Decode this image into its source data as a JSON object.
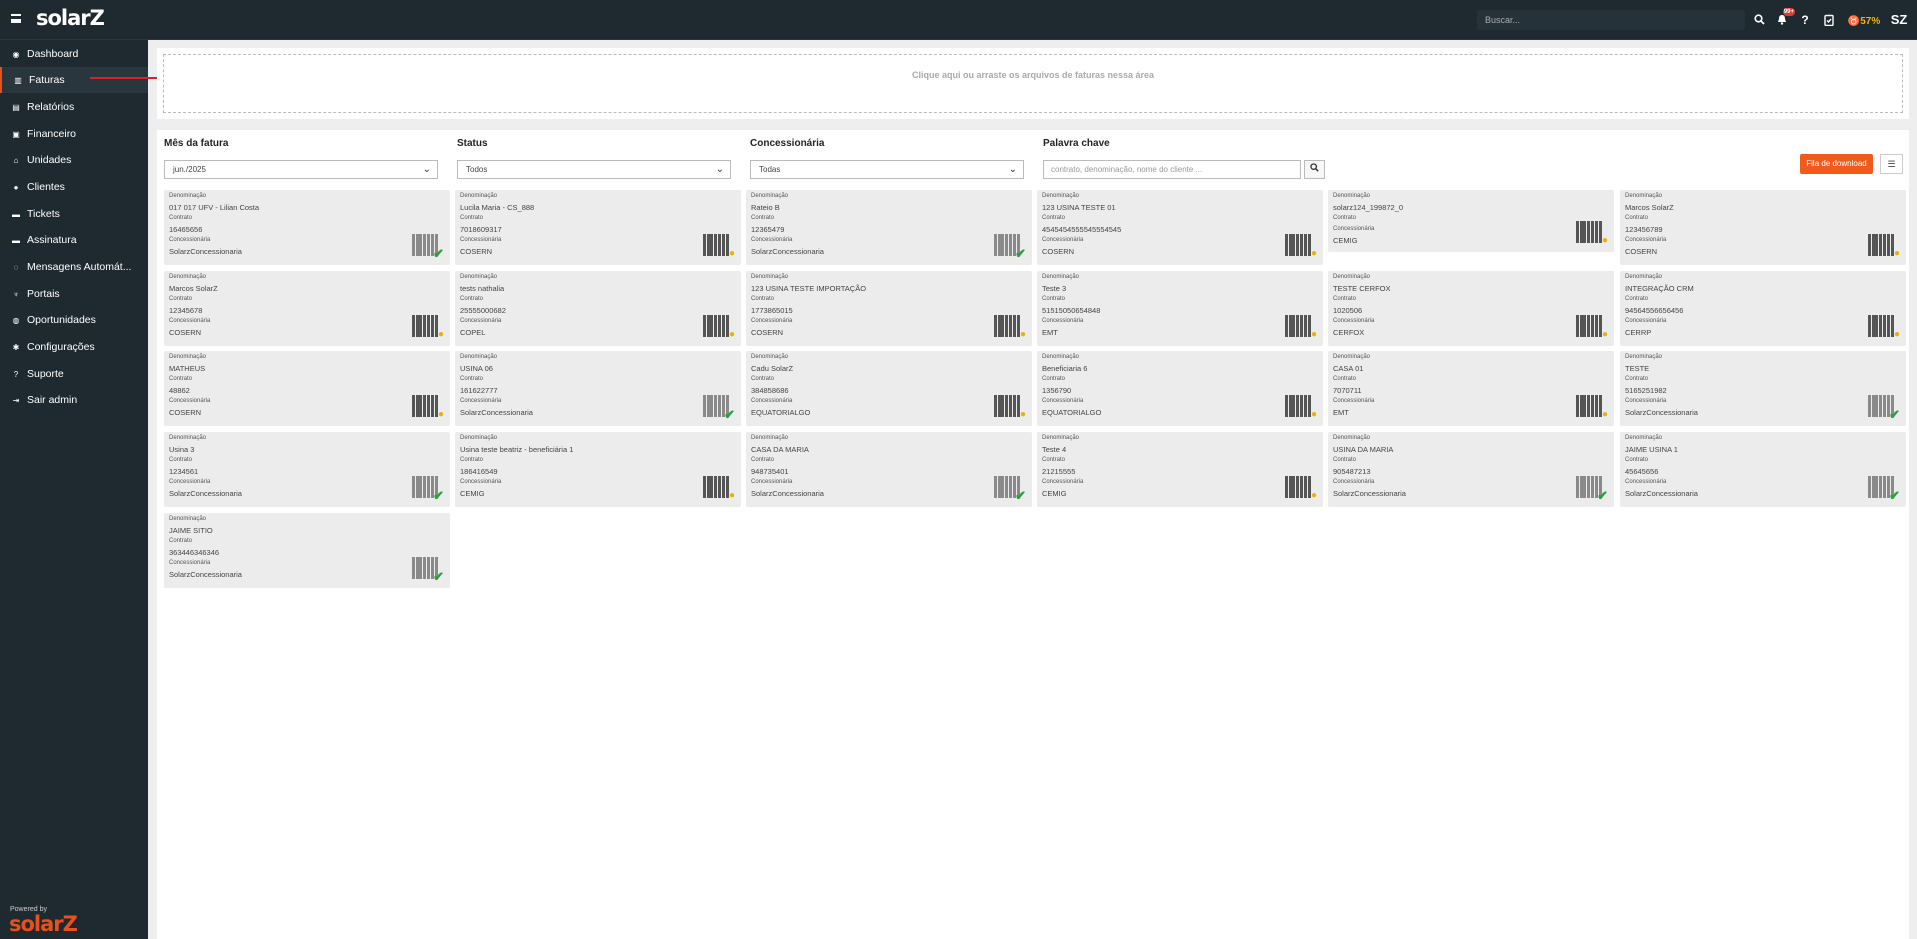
{
  "header": {
    "brand": "solarZ",
    "search_placeholder": "Buscar...",
    "notif_badge": "99+",
    "help": "?",
    "progress": "57%",
    "avatar": "SZ"
  },
  "sidebar": {
    "items": [
      {
        "label": "Dashboard",
        "icon": "gauge-icon",
        "glyph": "◉"
      },
      {
        "label": "Faturas",
        "icon": "invoice-icon",
        "glyph": "▥"
      },
      {
        "label": "Relatórios",
        "icon": "report-icon",
        "glyph": "▤"
      },
      {
        "label": "Financeiro",
        "icon": "money-icon",
        "glyph": "▣"
      },
      {
        "label": "Unidades",
        "icon": "home-icon",
        "glyph": "⌂"
      },
      {
        "label": "Clientes",
        "icon": "user-icon",
        "glyph": "●"
      },
      {
        "label": "Tickets",
        "icon": "ticket-icon",
        "glyph": "▬"
      },
      {
        "label": "Assinatura",
        "icon": "signature-icon",
        "glyph": "▬"
      },
      {
        "label": "Mensagens Automát...",
        "icon": "whatsapp-icon",
        "glyph": "◌"
      },
      {
        "label": "Portais",
        "icon": "plug-icon",
        "glyph": "♆"
      },
      {
        "label": "Oportunidades",
        "icon": "search-icon",
        "glyph": "◍"
      },
      {
        "label": "Configurações",
        "icon": "gear-icon",
        "glyph": "✱"
      },
      {
        "label": "Suporte",
        "icon": "question-icon",
        "glyph": "?"
      },
      {
        "label": "Sair admin",
        "icon": "logout-icon",
        "glyph": "⇥"
      }
    ],
    "powered_by": "Powered by",
    "powered_logo": "solarZ"
  },
  "dropzone": {
    "text": "Clique aqui ou arraste os arquivos de faturas nessa área"
  },
  "filters": {
    "month_label": "Mês da fatura",
    "month_value": "jun./2025",
    "status_label": "Status",
    "status_value": "Todos",
    "utility_label": "Concessionária",
    "utility_value": "Todas",
    "keyword_label": "Palavra chave",
    "keyword_placeholder": "contrato, denominação, nome do cliente ...",
    "download_queue": "Fila de download"
  },
  "labels": {
    "denominacao": "Denominação",
    "contrato": "Contrato",
    "concessionaria": "Concessionária"
  },
  "colors": {
    "accent": "#f05a1a",
    "sidebar": "#1f2a30",
    "ok": "#2e9e3e",
    "pending": "#e9b100"
  },
  "cards": [
    {
      "name": "017 017 UFV - Lilian Costa",
      "contract": "16465656",
      "utility": "SolarzConcessionaria",
      "status": "ok"
    },
    {
      "name": "Lucila Maria - CS_888",
      "contract": "7018609317",
      "utility": "COSERN",
      "status": "pending"
    },
    {
      "name": "Rateio B",
      "contract": "12365479",
      "utility": "SolarzConcessionaria",
      "status": "ok"
    },
    {
      "name": "123 USINA TESTE 01",
      "contract": "4545454555545554545",
      "utility": "COSERN",
      "status": "pending"
    },
    {
      "name": "solarz124_199872_0",
      "contract": "",
      "utility": "CEMIG",
      "status": "pending",
      "short": true
    },
    {
      "name": "Marcos SolarZ",
      "contract": "123456789",
      "utility": "COSERN",
      "status": "pending"
    },
    {
      "name": "Marcos SolarZ",
      "contract": "12345678",
      "utility": "COSERN",
      "status": "pending"
    },
    {
      "name": "tests nathalia",
      "contract": "25555000682",
      "utility": "COPEL",
      "status": "pending"
    },
    {
      "name": "123 USINA TESTE IMPORTAÇÃO",
      "contract": "1773865015",
      "utility": "COSERN",
      "status": "pending"
    },
    {
      "name": "Teste 3",
      "contract": "51515050654848",
      "utility": "EMT",
      "status": "pending"
    },
    {
      "name": "TESTE CERFOX",
      "contract": "1020506",
      "utility": "CERFOX",
      "status": "pending"
    },
    {
      "name": "INTEGRAÇÃO CRM",
      "contract": "94564556656456",
      "utility": "CERRP",
      "status": "pending"
    },
    {
      "name": "MATHEUS",
      "contract": "48862",
      "utility": "COSERN",
      "status": "pending"
    },
    {
      "name": "USINA 06",
      "contract": "161622777",
      "utility": "SolarzConcessionaria",
      "status": "ok"
    },
    {
      "name": "Cadu SolarZ",
      "contract": "384858686",
      "utility": "EQUATORIALGO",
      "status": "pending"
    },
    {
      "name": "Beneficiaria 6",
      "contract": "1356790",
      "utility": "EQUATORIALGO",
      "status": "pending"
    },
    {
      "name": "CASA 01",
      "contract": "7070711",
      "utility": "EMT",
      "status": "pending"
    },
    {
      "name": "TESTE",
      "contract": "5165251982",
      "utility": "SolarzConcessionaria",
      "status": "ok"
    },
    {
      "name": "Usina 3",
      "contract": "1234561",
      "utility": "SolarzConcessionaria",
      "status": "ok"
    },
    {
      "name": "Usina teste beatriz - beneficiária 1",
      "contract": "186416549",
      "utility": "CEMIG",
      "status": "pending"
    },
    {
      "name": "CASA DA MARIA",
      "contract": "948735401",
      "utility": "SolarzConcessionaria",
      "status": "ok"
    },
    {
      "name": "Teste 4",
      "contract": "21215555",
      "utility": "CEMIG",
      "status": "pending"
    },
    {
      "name": "USINA DA MARIA",
      "contract": "905487213",
      "utility": "SolarzConcessionaria",
      "status": "ok"
    },
    {
      "name": "JAIME USINA 1",
      "contract": "45645656",
      "utility": "SolarzConcessionaria",
      "status": "ok"
    },
    {
      "name": "JAIME SITIO",
      "contract": "363446346346",
      "utility": "SolarzConcessionaria",
      "status": "ok"
    }
  ]
}
